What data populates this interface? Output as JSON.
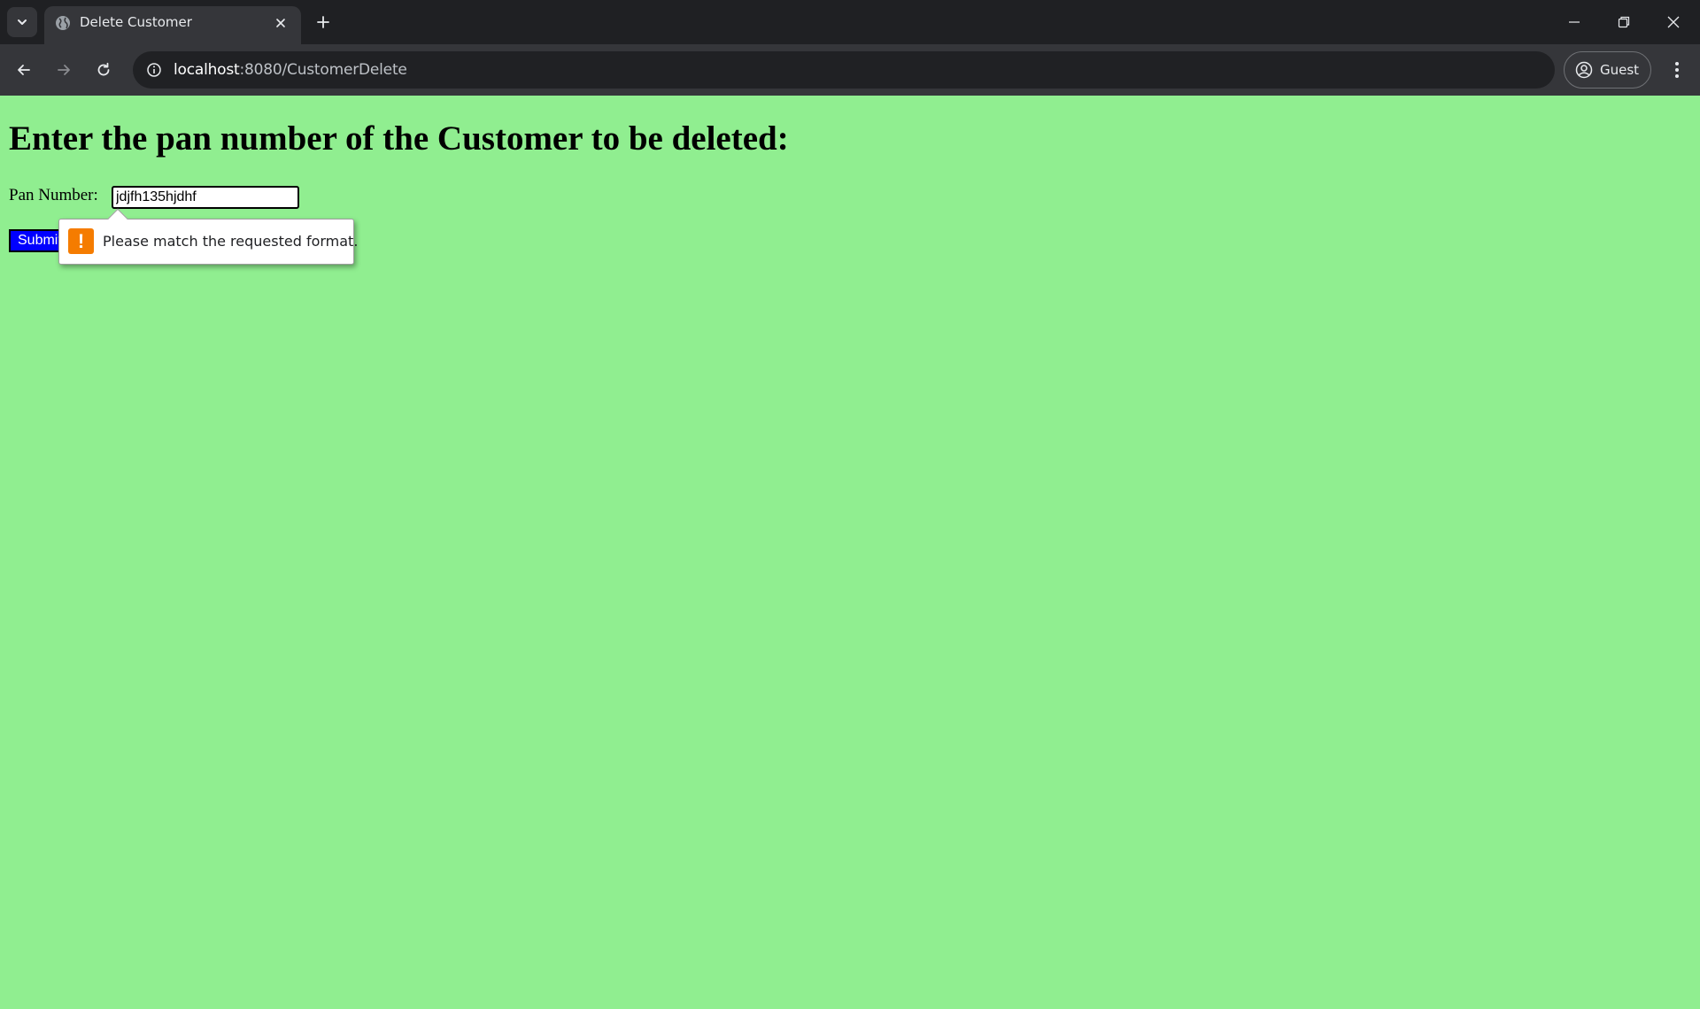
{
  "browser": {
    "tab": {
      "title": "Delete Customer"
    },
    "url": {
      "host": "localhost",
      "path": ":8080/CustomerDelete"
    },
    "profile": {
      "label": "Guest"
    }
  },
  "page": {
    "heading": "Enter the pan number of the Customer to be deleted:",
    "pan_label": "Pan Number:",
    "pan_value": "jdjfh135hjdhf",
    "submit_label": "Submit",
    "validation_message": "Please match the requested format.",
    "validation_icon": "exclamation-icon",
    "background_color": "#90ee90",
    "submit_color": "#0000ff",
    "warning_color": "#f57c00"
  }
}
